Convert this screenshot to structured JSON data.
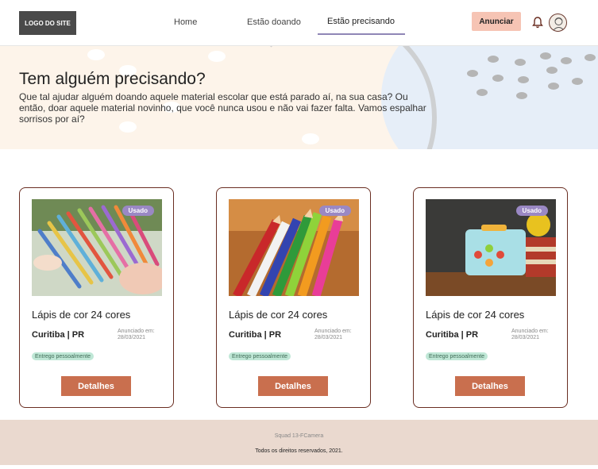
{
  "header": {
    "logo": "LOGO DO SITE",
    "nav": [
      "Home",
      "Estão doando",
      "Estão precisando"
    ],
    "active_nav": "Estão precisando",
    "cta": "Anunciar",
    "icons": [
      "bell-icon",
      "avatar"
    ]
  },
  "hero": {
    "title": "Tem alguém precisando?",
    "text": "Que tal ajudar alguém doando aquele material escolar que está parado aí, na sua casa? Ou então, doar aquele material novinho, que você nunca usou e não vai fazer falta. Vamos espalhar sorrisos por aí?"
  },
  "cards": [
    {
      "badge": "Usado",
      "title": "Lápis de cor 24 cores",
      "city": "Curitiba | PR",
      "date_label": "Anunciado em:",
      "date": "28/03/2021",
      "tag": "Entrego pessoalmente",
      "button": "Detalhes"
    },
    {
      "badge": "Usado",
      "title": "Lápis de cor 24 cores",
      "city": "Curitiba | PR",
      "date_label": "Anunciado em:",
      "date": "28/03/2021",
      "tag": "Entrego pessoalmente",
      "button": "Detalhes"
    },
    {
      "badge": "Usado",
      "title": "Lápis de cor 24 cores",
      "city": "Curitiba | PR",
      "date_label": "Anunciado em:",
      "date": "28/03/2021",
      "tag": "Entrego pessoalmente",
      "button": "Detalhes"
    }
  ],
  "footer": {
    "squad": "Squad 13-FCamera",
    "rights": "Todos os direitos reservados, 2021."
  },
  "colors": {
    "accent": "#c96f4e",
    "cta": "#f6c4b4",
    "badge": "#9a88c4",
    "card_border": "#6a2e22",
    "hero_bg": "#fdf4ea",
    "footer_bg": "#ead9cf",
    "tag_bg": "#bfe7d6"
  }
}
